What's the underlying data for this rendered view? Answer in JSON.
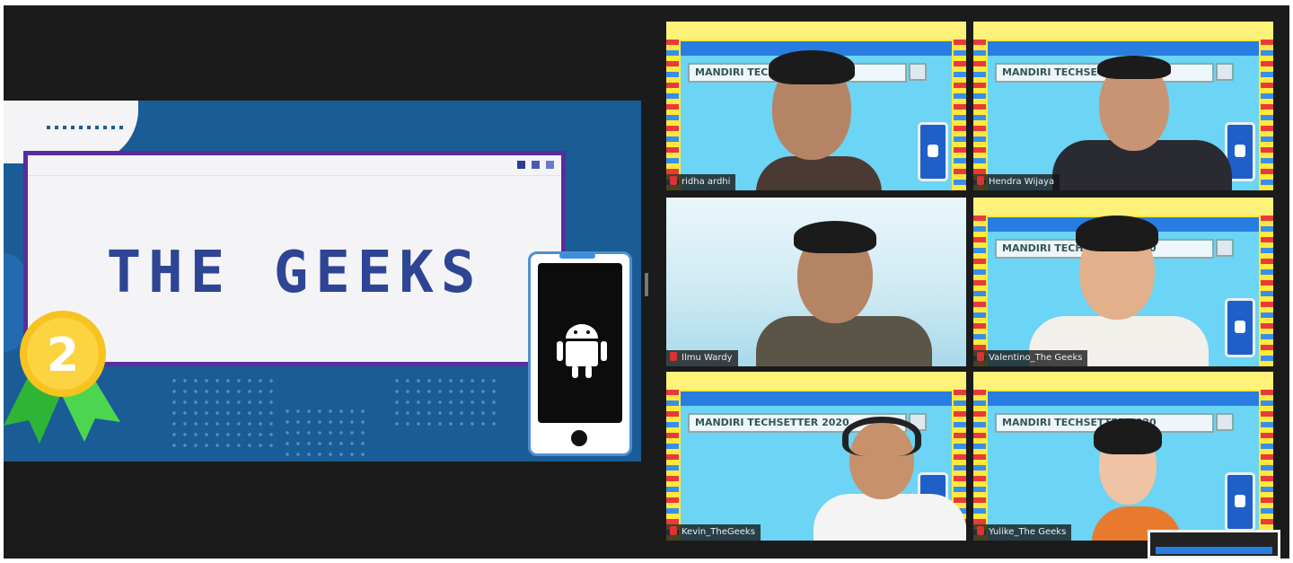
{
  "meeting": {
    "shared_screen": {
      "title": "THE GEEKS",
      "medal_rank": "2",
      "phone_icon": "android-icon"
    },
    "tile_search_text": "MANDIRI TECHSETTER 2020",
    "participants": [
      {
        "name": "ridha ardhi"
      },
      {
        "name": "Hendra Wijaya"
      },
      {
        "name": "Ilmu Wardy"
      },
      {
        "name": "Valentino_The Geeks"
      },
      {
        "name": "Kevin_TheGeeks"
      },
      {
        "name": "Yulike_The Geeks"
      }
    ]
  },
  "colors": {
    "background": "#1b1b1b",
    "slide_blue": "#1a5c96",
    "title_text": "#2e4595",
    "window_border": "#5b2c9e",
    "medal_gold": "#f7c31f",
    "ribbon_green": "#3ec941",
    "tile_yellow": "#ffe93d",
    "tile_sky": "#6cd4f4",
    "mic_muted": "#e03131"
  }
}
